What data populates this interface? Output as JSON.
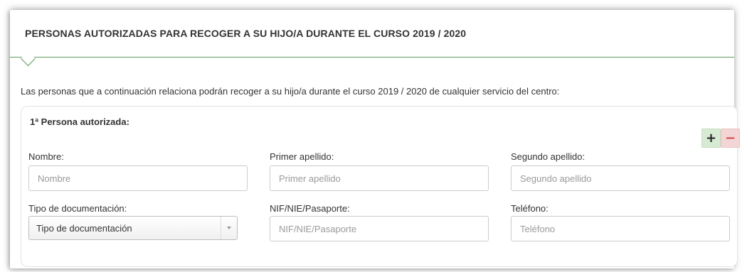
{
  "section": {
    "title": "PERSONAS AUTORIZADAS PARA RECOGER A SU HIJO/A DURANTE EL CURSO 2019 / 2020",
    "intro": "Las personas que a continuación relaciona podrán recoger a su hijo/a durante el curso 2019 / 2020 de cualquier servicio del centro:"
  },
  "person": {
    "title": "1ª Persona autorizada:",
    "add_label": "+",
    "remove_label": "−",
    "fields": {
      "nombre": {
        "label": "Nombre:",
        "placeholder": "Nombre",
        "value": ""
      },
      "primer_apellido": {
        "label": "Primer apellido:",
        "placeholder": "Primer apellido",
        "value": ""
      },
      "segundo_apellido": {
        "label": "Segundo apellido:",
        "placeholder": "Segundo apellido",
        "value": ""
      },
      "tipo_documentacion": {
        "label": "Tipo de documentación:",
        "selected": "Tipo de documentación"
      },
      "nif": {
        "label": "NIF/NIE/Pasaporte:",
        "placeholder": "NIF/NIE/Pasaporte",
        "value": ""
      },
      "telefono": {
        "label": "Teléfono:",
        "placeholder": "Teléfono",
        "value": ""
      }
    }
  },
  "colors": {
    "header_line": "#5e9a5e",
    "add_button_bg": "#d7ead3",
    "remove_button_bg": "#f4d5d5",
    "remove_button_fg": "#d24a4a"
  }
}
